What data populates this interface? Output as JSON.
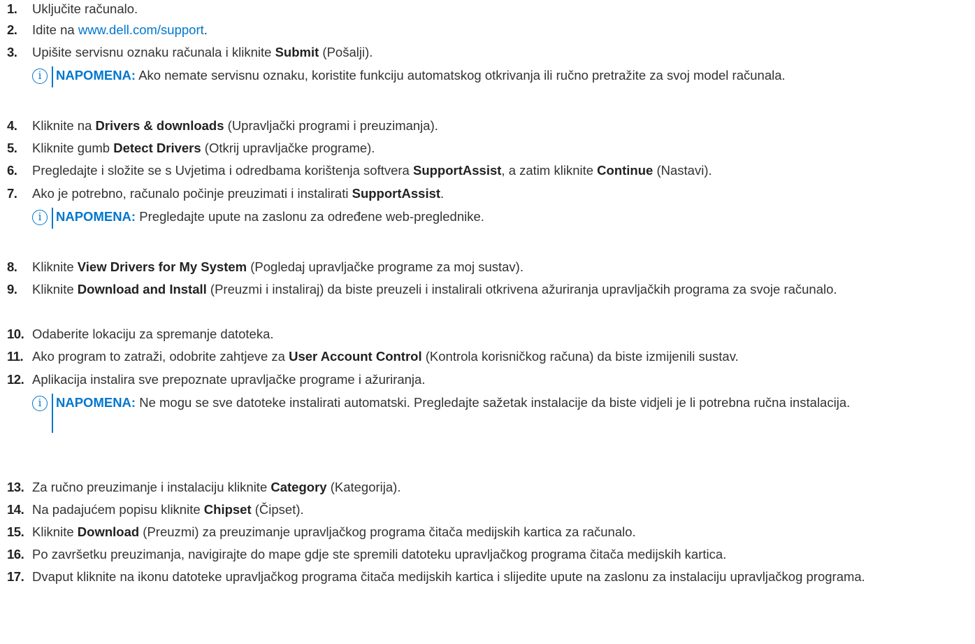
{
  "steps": [
    {
      "num": "1.",
      "parts": [
        {
          "t": "Uključite računalo."
        }
      ]
    },
    {
      "num": "2.",
      "parts": [
        {
          "t": "Idite na "
        },
        {
          "t": "www.dell.com/support",
          "link": true
        },
        {
          "t": "."
        }
      ]
    },
    {
      "num": "3.",
      "parts": [
        {
          "t": "Upišite servisnu oznaku računala i kliknite "
        },
        {
          "t": "Submit",
          "b": true
        },
        {
          "t": " (Pošalji)."
        }
      ]
    },
    {
      "num": "4.",
      "parts": [
        {
          "t": "Kliknite na "
        },
        {
          "t": "Drivers & downloads",
          "b": true
        },
        {
          "t": " (Upravljački programi i preuzimanja)."
        }
      ]
    },
    {
      "num": "5.",
      "parts": [
        {
          "t": "Kliknite gumb "
        },
        {
          "t": "Detect Drivers",
          "b": true
        },
        {
          "t": " (Otkrij upravljačke programe)."
        }
      ]
    },
    {
      "num": "6.",
      "parts": [
        {
          "t": "Pregledajte i složite se s Uvjetima i odredbama korištenja softvera "
        },
        {
          "t": "SupportAssist",
          "b": true
        },
        {
          "t": ", a zatim kliknite "
        },
        {
          "t": "Continue",
          "b": true
        },
        {
          "t": " (Nastavi)."
        }
      ]
    },
    {
      "num": "7.",
      "parts": [
        {
          "t": "Ako je potrebno, računalo počinje preuzimati i instalirati "
        },
        {
          "t": "SupportAssist",
          "b": true
        },
        {
          "t": "."
        }
      ]
    },
    {
      "num": "8.",
      "parts": [
        {
          "t": "Kliknite "
        },
        {
          "t": "View Drivers for My System",
          "b": true
        },
        {
          "t": " (Pogledaj upravljačke programe za moj sustav)."
        }
      ]
    },
    {
      "num": "9.",
      "parts": [
        {
          "t": "Kliknite "
        },
        {
          "t": "Download and Install",
          "b": true
        },
        {
          "t": " (Preuzmi i instaliraj) da biste preuzeli i instalirali otkrivena ažuriranja upravljačkih programa za svoje računalo."
        }
      ]
    },
    {
      "num": "10.",
      "parts": [
        {
          "t": "Odaberite lokaciju za spremanje datoteka."
        }
      ]
    },
    {
      "num": "11.",
      "parts": [
        {
          "t": "Ako program to zatraži, odobrite zahtjeve za "
        },
        {
          "t": "User Account Control",
          "b": true
        },
        {
          "t": " (Kontrola korisničkog računa) da biste izmijenili sustav."
        }
      ]
    },
    {
      "num": "12.",
      "parts": [
        {
          "t": "Aplikacija instalira sve prepoznate upravljačke programe i ažuriranja."
        }
      ]
    },
    {
      "num": "13.",
      "parts": [
        {
          "t": "Za ručno preuzimanje i instalaciju kliknite "
        },
        {
          "t": "Category",
          "b": true
        },
        {
          "t": " (Kategorija)."
        }
      ]
    },
    {
      "num": "14.",
      "parts": [
        {
          "t": "Na padajućem popisu kliknite "
        },
        {
          "t": "Chipset",
          "b": true
        },
        {
          "t": " (Čipset)."
        }
      ]
    },
    {
      "num": "15.",
      "parts": [
        {
          "t": "Kliknite "
        },
        {
          "t": "Download",
          "b": true
        },
        {
          "t": " (Preuzmi) za preuzimanje upravljačkog programa čitača medijskih kartica za računalo."
        }
      ]
    },
    {
      "num": "16.",
      "parts": [
        {
          "t": "Po završetku preuzimanja, navigirajte do mape gdje ste spremili datoteku upravljačkog programa čitača medijskih kartica."
        }
      ]
    },
    {
      "num": "17.",
      "parts": [
        {
          "t": "Dvaput kliknite na ikonu datoteke upravljačkog programa čitača medijskih kartica i slijedite upute na zaslonu za instalaciju upravljačkog programa."
        }
      ]
    }
  ],
  "notes": [
    {
      "label": "NAPOMENA:",
      "text": " Ako nemate servisnu oznaku, koristite funkciju automatskog otkrivanja ili ručno pretražite za svoj model računala."
    },
    {
      "label": "NAPOMENA:",
      "text": " Pregledajte upute na zaslonu za određene web-preglednike."
    },
    {
      "label": "NAPOMENA:",
      "text": " Ne mogu se sve datoteke instalirati automatski. Pregledajte sažetak instalacije da biste vidjeli je li potrebna ručna instalacija."
    }
  ]
}
